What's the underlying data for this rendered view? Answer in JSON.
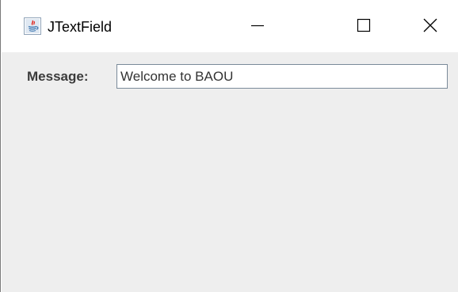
{
  "window": {
    "title": "JTextField",
    "app_icon": "java-icon",
    "controls": {
      "minimize_icon": "minimize-icon",
      "maximize_icon": "maximize-icon",
      "close_icon": "close-icon"
    }
  },
  "form": {
    "message_label": "Message:",
    "message_value": "Welcome to BAOU"
  },
  "colors": {
    "titlebar_bg": "#ffffff",
    "content_bg": "#eeeeee",
    "label_text": "#3b3b3b",
    "input_border": "#7a8a99"
  }
}
